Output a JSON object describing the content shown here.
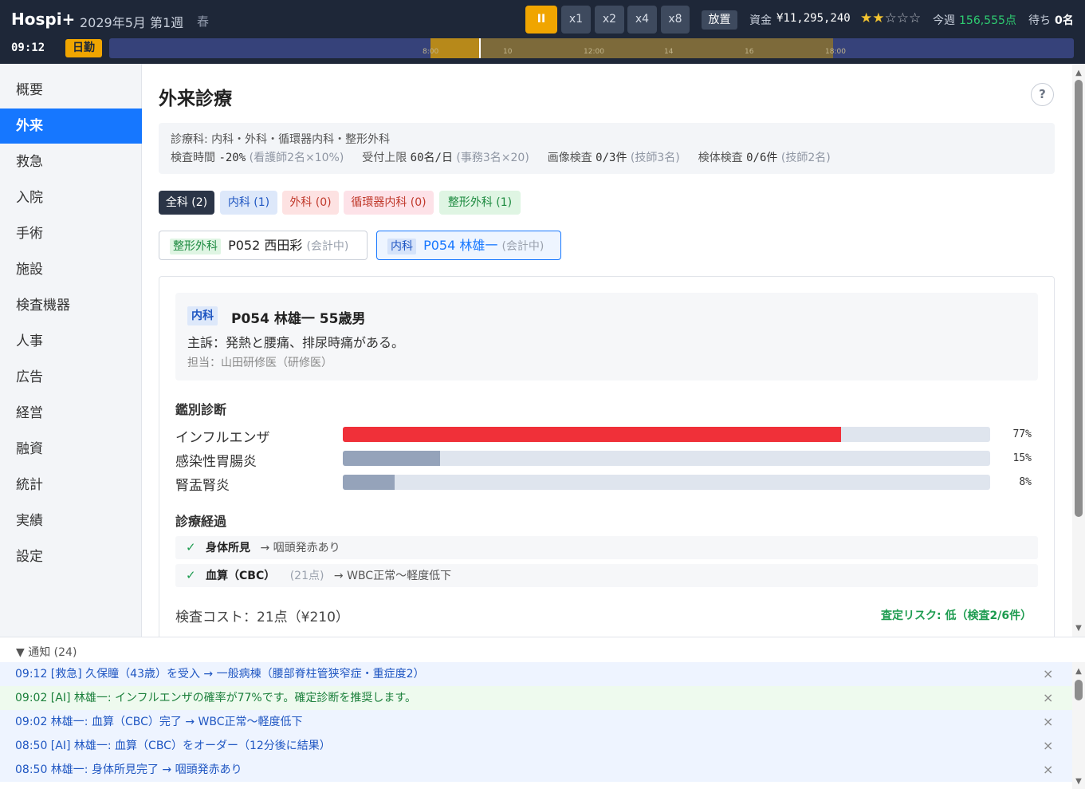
{
  "header": {
    "app_title": "Hospi+",
    "date": "2029年5月 第1週",
    "season": "春",
    "speed_buttons": [
      {
        "label": "II",
        "active": true
      },
      {
        "label": "x1"
      },
      {
        "label": "x2"
      },
      {
        "label": "x4"
      },
      {
        "label": "x8"
      }
    ],
    "auto_label": "放置",
    "funds_label": "資金",
    "funds_value": "¥11,295,240",
    "rating_stars": 2,
    "rating_max": 5,
    "week_label": "今週",
    "week_points": "156,555点",
    "wait_label": "待ち",
    "wait_value": "0名",
    "clock": "09:12",
    "shift": "日勤",
    "timeline": {
      "ticks": [
        "8:00",
        "10",
        "12:00",
        "14",
        "16",
        "18:00"
      ],
      "day_start_hour": 8,
      "day_end_hour": 18,
      "current_hour": 9.2
    }
  },
  "sidebar": {
    "items": [
      {
        "label": "概要"
      },
      {
        "label": "外来",
        "active": true
      },
      {
        "label": "救急"
      },
      {
        "label": "入院"
      },
      {
        "label": "手術"
      },
      {
        "label": "施設"
      },
      {
        "label": "検査機器"
      },
      {
        "label": "人事"
      },
      {
        "label": "広告"
      },
      {
        "label": "経営"
      },
      {
        "label": "融資"
      },
      {
        "label": "統計"
      },
      {
        "label": "実績"
      },
      {
        "label": "設定"
      }
    ]
  },
  "main": {
    "title": "外来診療",
    "help": "?",
    "info": {
      "departments": "診療科: 内科・外科・循環器内科・整形外科",
      "exam_time_label": "検査時間",
      "exam_time_value": "-20%",
      "exam_time_note": "(看護師2名×10%)",
      "reception_label": "受付上限",
      "reception_value": "60名/日",
      "reception_note": "(事務3名×20)",
      "imaging_label": "画像検査",
      "imaging_value": "0/3件",
      "imaging_note": "(技師3名)",
      "specimen_label": "検体検査",
      "specimen_value": "0/6件",
      "specimen_note": "(技師2名)"
    },
    "filters": [
      {
        "label": "全科 (2)"
      },
      {
        "label": "内科 (1)"
      },
      {
        "label": "外科 (0)"
      },
      {
        "label": "循環器内科 (0)"
      },
      {
        "label": "整形外科 (1)"
      }
    ],
    "filter_colors": [
      "#2b3547",
      "#dde8fa",
      "#fde2e2",
      "#fde2e8",
      "#dff5e3"
    ],
    "filter_text_colors": [
      "#ffffff",
      "#1f56c2",
      "#c0392b",
      "#c0392b",
      "#1c8a3f"
    ],
    "cases": [
      {
        "dept": "整形外科",
        "name": "P052 西田彩",
        "status": "(会計中)"
      },
      {
        "dept": "内科",
        "name": "P054 林雄一",
        "status": "(会計中)"
      }
    ],
    "patient": {
      "dept": "内科",
      "name": "P054 林雄一 55歳男",
      "complaint": "主訴：発熱と腰痛、排尿時痛がある。",
      "doctor": "担当：山田研修医（研修医）"
    },
    "ddx_title": "鑑別診断",
    "ddx": [
      {
        "name": "インフルエンザ",
        "value": 77,
        "pct": "77%"
      },
      {
        "name": "感染性胃腸炎",
        "value": 15,
        "pct": "15%"
      },
      {
        "name": "腎盂腎炎",
        "value": 8,
        "pct": "8%"
      }
    ],
    "course_title": "診療経過",
    "course": [
      {
        "check": "✓",
        "label": "身体所見",
        "pts": "",
        "result": "→ 咽頭発赤あり"
      },
      {
        "check": "✓",
        "label": "血算（CBC）",
        "pts": "(21点)",
        "result": "→ WBC正常〜軽度低下"
      }
    ],
    "cost": "検査コスト：21点（¥210）",
    "risk": "査定リスク: 低（検査2/6件）"
  },
  "notifications": {
    "header": "▼ 通知 (24)",
    "items": [
      {
        "text": "09:12 [救急] 久保瞳（43歳）を受入 → 一般病棟（腰部脊柱管狭窄症・重症度2）",
        "kind": "blue"
      },
      {
        "text": "09:02 [AI] 林雄一: インフルエンザの確率が77%です。確定診断を推奨します。",
        "kind": "green"
      },
      {
        "text": "09:02 林雄一: 血算（CBC）完了 → WBC正常〜軽度低下",
        "kind": "blue"
      },
      {
        "text": "08:50 [AI] 林雄一: 血算（CBC）をオーダー（12分後に結果）",
        "kind": "blue"
      },
      {
        "text": "08:50 林雄一: 身体所見完了 → 咽頭発赤あり",
        "kind": "blue"
      }
    ],
    "close_glyph": "×"
  }
}
